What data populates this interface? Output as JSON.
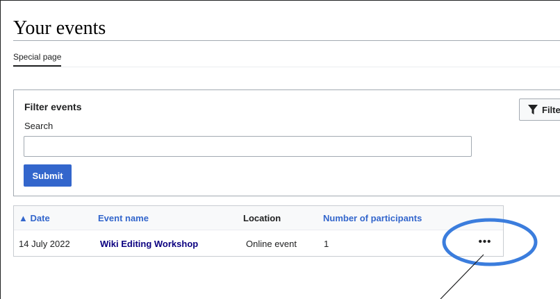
{
  "page": {
    "title": "Your events"
  },
  "tabs": [
    {
      "label": "Special page"
    }
  ],
  "filter": {
    "title": "Filter events",
    "search_label": "Search",
    "search_value": "",
    "submit_label": "Submit",
    "filters_button_label": "Filte"
  },
  "table": {
    "sort_indicator": "▲",
    "columns": [
      {
        "label": "Date"
      },
      {
        "label": "Event name"
      },
      {
        "label": "Location"
      },
      {
        "label": "Number of participants"
      }
    ],
    "rows": [
      {
        "date": "14 July 2022",
        "event_name": "Wiki Editing Workshop",
        "location": "Online event",
        "participants": "1",
        "more": "•••"
      }
    ]
  },
  "annotation": {
    "highlight_color": "#3b7ddd"
  },
  "colors": {
    "accent": "#3366cc",
    "link": "#0b0080"
  }
}
